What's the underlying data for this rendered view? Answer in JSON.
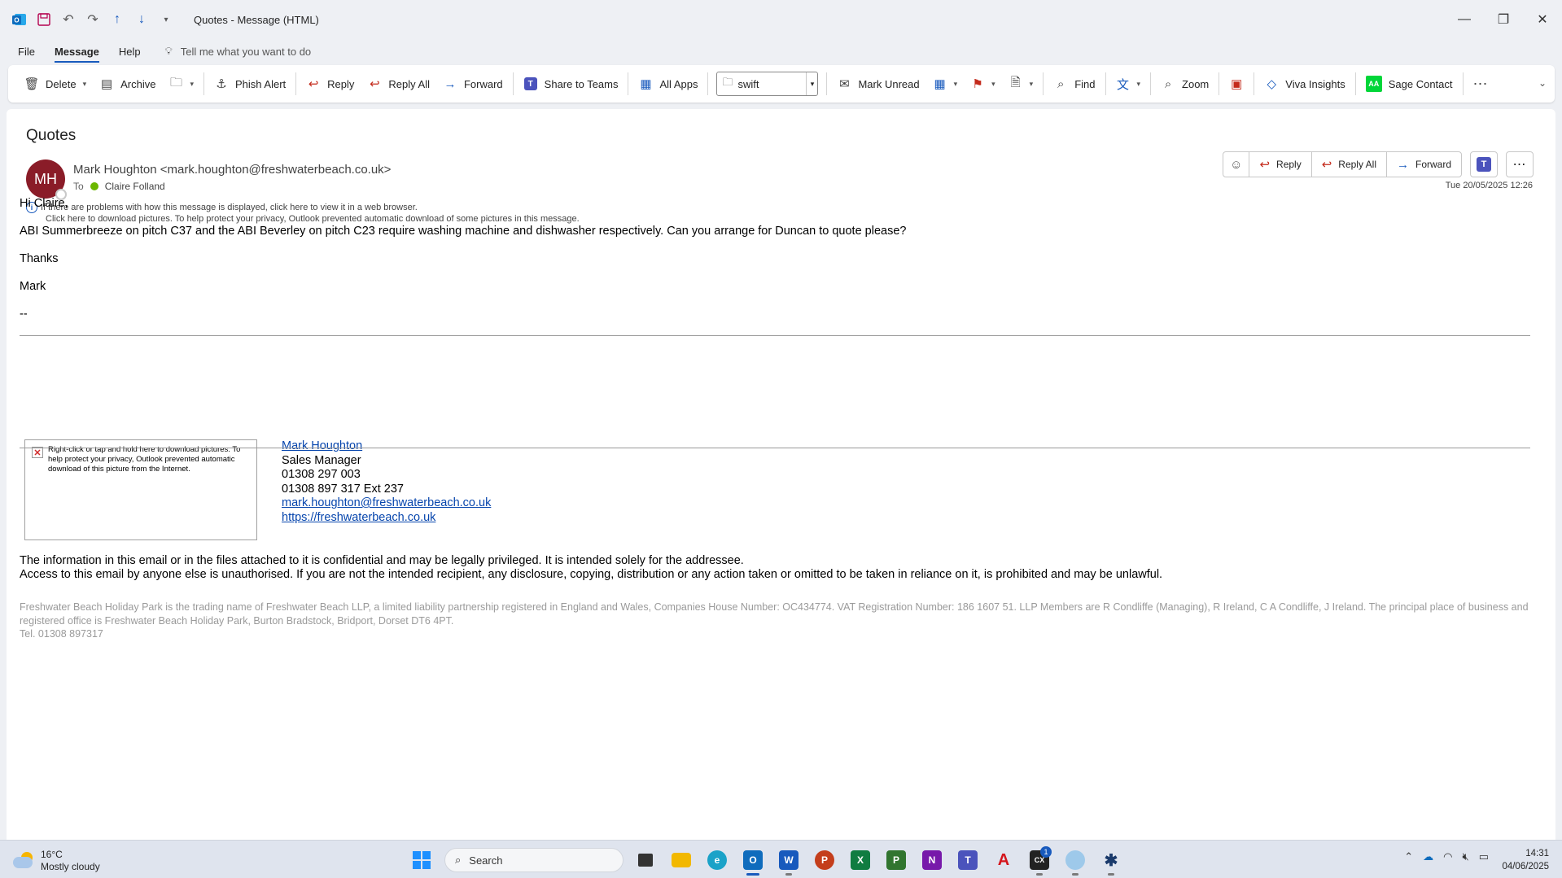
{
  "window": {
    "title": "Quotes  -  Message (HTML)"
  },
  "menu": {
    "items": [
      "File",
      "Message",
      "Help"
    ],
    "tell_me": "Tell me what you want to do"
  },
  "ribbon": {
    "delete": "Delete",
    "archive": "Archive",
    "phish_alert": "Phish Alert",
    "reply": "Reply",
    "reply_all": "Reply All",
    "forward": "Forward",
    "share_to_teams": "Share to Teams",
    "all_apps": "All Apps",
    "quick_step_value": "swift",
    "mark_unread": "Mark Unread",
    "find": "Find",
    "zoom": "Zoom",
    "viva_insights": "Viva Insights",
    "sage_contact": "Sage Contact",
    "sage_badge": "AA"
  },
  "message": {
    "subject": "Quotes",
    "avatar_initials": "MH",
    "sender": "Mark Houghton <mark.houghton@freshwaterbeach.co.uk>",
    "to_label": "To",
    "to": "Claire Folland",
    "info_line1": "If there are problems with how this message is displayed, click here to view it in a web browser.",
    "info_line2": "Click here to download pictures. To help protect your privacy, Outlook prevented automatic download of some pictures in this message.",
    "date": "Tue 20/05/2025 12:26",
    "actions": {
      "reply": "Reply",
      "reply_all": "Reply All",
      "forward": "Forward"
    },
    "body": {
      "greeting": "Hi Claire,",
      "paragraph": "ABI Summerbreeze on pitch C37 and the ABI Beverley on pitch C23 require washing machine and dishwasher respectively. Can you arrange for Duncan to quote please?",
      "thanks": "Thanks",
      "name": "Mark",
      "sig_sep": "--"
    },
    "signature": {
      "image_note": "Right-click or tap and hold here to download pictures. To help protect your privacy, Outlook prevented automatic download of this picture from the Internet.",
      "name": "Mark Houghton",
      "role": "Sales Manager",
      "phone1": "01308 297 003",
      "phone2": "01308 897 317 Ext 237",
      "email": "mark.houghton@freshwaterbeach.co.uk",
      "website": "https://freshwaterbeach.co.uk"
    },
    "disclaimer_line1": "The information in this email or in the files attached to it is confidential and may be legally privileged. It is intended solely for the addressee.",
    "disclaimer_line2": "Access to this email by anyone else is unauthorised. If you are not the intended recipient, any disclosure, copying, distribution or any action taken or omitted to be taken in reliance on it, is prohibited and may be unlawful.",
    "legal": "Freshwater Beach Holiday Park is the trading name of Freshwater Beach LLP, a limited liability partnership registered in England and Wales, Companies House Number: OC434774. VAT Registration Number: 186 1607 51. LLP Members are R Condliffe (Managing), R Ireland, C A Condliffe, J Ireland. The principal place of business and registered office is Freshwater Beach Holiday Park, Burton Bradstock, Bridport, Dorset DT6 4PT.",
    "legal_tel": "Tel. 01308 897317"
  },
  "taskbar": {
    "temp": "16°C",
    "condition": "Mostly cloudy",
    "search": "Search",
    "time": "14:31",
    "date": "04/06/2025",
    "notification_count": "1"
  },
  "colors": {
    "accent": "#185abd",
    "avatar": "#8a1c28",
    "flag": "#c42b1c",
    "sage": "#00d639"
  }
}
